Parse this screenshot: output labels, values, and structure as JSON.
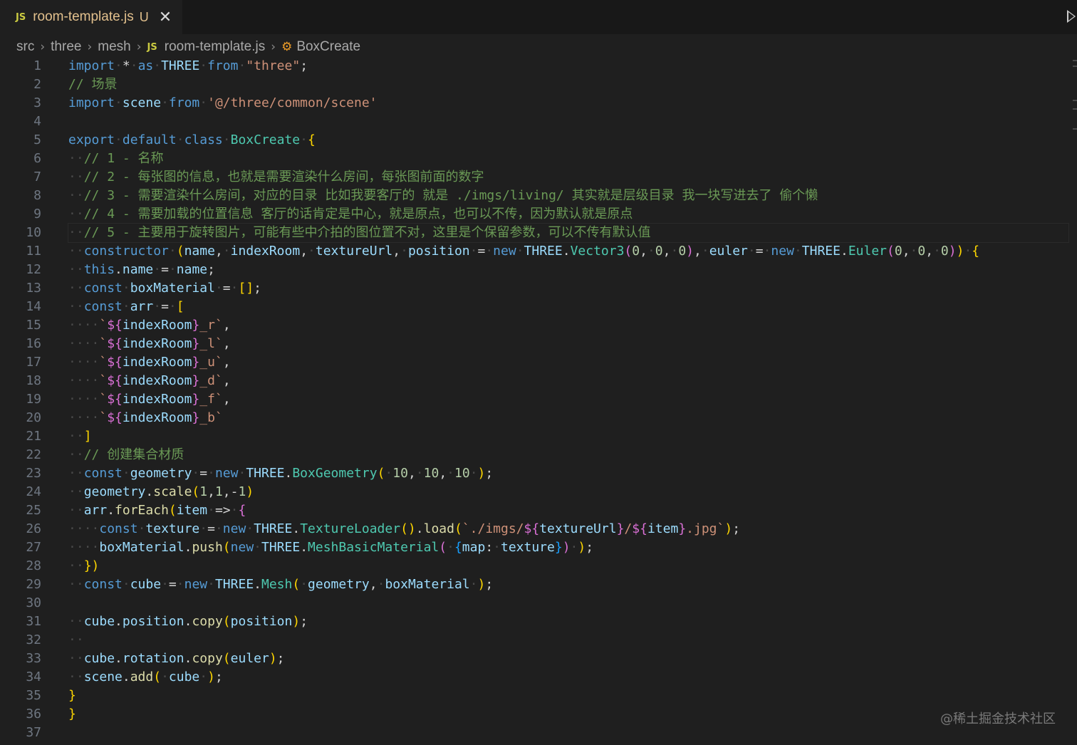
{
  "tab": {
    "icon_text": "JS",
    "title": "room-template.js",
    "status": "U",
    "close_glyph": "✕"
  },
  "breadcrumb": {
    "items": [
      "src",
      "three",
      "mesh"
    ],
    "file_icon_text": "JS",
    "file": "room-template.js",
    "symbol": "BoxCreate",
    "separator": "›"
  },
  "editor": {
    "language": "javascript",
    "current_line": 10,
    "line_numbers": [
      "1",
      "2",
      "3",
      "4",
      "5",
      "6",
      "7",
      "8",
      "9",
      "10",
      "11",
      "12",
      "13",
      "14",
      "15",
      "16",
      "17",
      "18",
      "19",
      "20",
      "21",
      "22",
      "23",
      "24",
      "25",
      "26",
      "27",
      "28",
      "29",
      "30",
      "31",
      "32",
      "33",
      "34",
      "35",
      "36",
      "37"
    ],
    "lines": [
      "import * as THREE from \"three\";",
      "// 场景",
      "import scene from '@/three/common/scene'",
      "",
      "export default class BoxCreate {",
      "  // 1 - 名称",
      "  // 2 - 每张图的信息，也就是需要渲染什么房间，每张图前面的数字",
      "  // 3 - 需要渲染什么房间，对应的目录 比如我要客厅的 就是 ./imgs/living/ 其实就是层级目录 我一块写进去了 偷个懒",
      "  // 4 - 需要加载的位置信息 客厅的话肯定是中心，就是原点，也可以不传，因为默认就是原点",
      "  // 5 - 主要用于旋转图片，可能有些中介拍的图位置不对，这里是个保留参数，可以不传有默认值",
      "  constructor (name, indexRoom, textureUrl, position = new THREE.Vector3(0, 0, 0), euler = new THREE.Euler(0, 0, 0)) {",
      "  this.name = name;",
      "  const boxMaterial = [];",
      "  const arr = [",
      "    `${indexRoom}_r`,",
      "    `${indexRoom}_l`,",
      "    `${indexRoom}_u`,",
      "    `${indexRoom}_d`,",
      "    `${indexRoom}_f`,",
      "    `${indexRoom}_b`",
      "  ]",
      "  // 创建集合材质",
      "  const geometry = new THREE.BoxGeometry( 10, 10, 10 );",
      "  geometry.scale(1,1,-1)",
      "  arr.forEach(item => {",
      "    const texture = new THREE.TextureLoader().load(`./imgs/${textureUrl}/${item}.jpg`);",
      "    boxMaterial.push(new THREE.MeshBasicMaterial( {map: texture}) );",
      "  })",
      "  const cube = new THREE.Mesh( geometry, boxMaterial );",
      "",
      "  cube.position.copy(position);",
      "  ",
      "  cube.rotation.copy(euler);",
      "  scene.add( cube );",
      "}",
      "}",
      ""
    ]
  },
  "watermark": "@稀土掘金技术社区",
  "colors": {
    "background": "#1f1f1f",
    "tabbar": "#181818",
    "keyword": "#569cd6",
    "string": "#ce9178",
    "comment": "#6a9955",
    "class": "#4ec9b0",
    "modified_file": "#e2c08d"
  }
}
